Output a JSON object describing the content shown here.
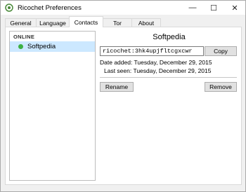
{
  "window": {
    "title": "Ricochet Preferences",
    "controls": {
      "minimize": "—",
      "maximize": "☐",
      "close": "✕"
    }
  },
  "tabs": [
    {
      "label": "General",
      "active": false
    },
    {
      "label": "Language",
      "active": false
    },
    {
      "label": "Contacts",
      "active": true
    },
    {
      "label": "Tor",
      "active": false
    },
    {
      "label": "About",
      "active": false
    }
  ],
  "contacts": {
    "group_header": "ONLINE",
    "items": [
      {
        "name": "Softpedia",
        "status": "online",
        "status_color": "#3cb043"
      }
    ]
  },
  "details": {
    "name": "Softpedia",
    "contact_id": "ricochet:3hk4upjfltcgxcwr",
    "copy_label": "Copy",
    "date_added_label": "Date added:",
    "date_added_value": "Tuesday, December 29, 2015",
    "last_seen_label": "Last seen:",
    "last_seen_value": "Tuesday, December 29, 2015",
    "rename_label": "Rename",
    "remove_label": "Remove"
  },
  "colors": {
    "selection": "#cce8ff",
    "online_status": "#3cb043"
  }
}
